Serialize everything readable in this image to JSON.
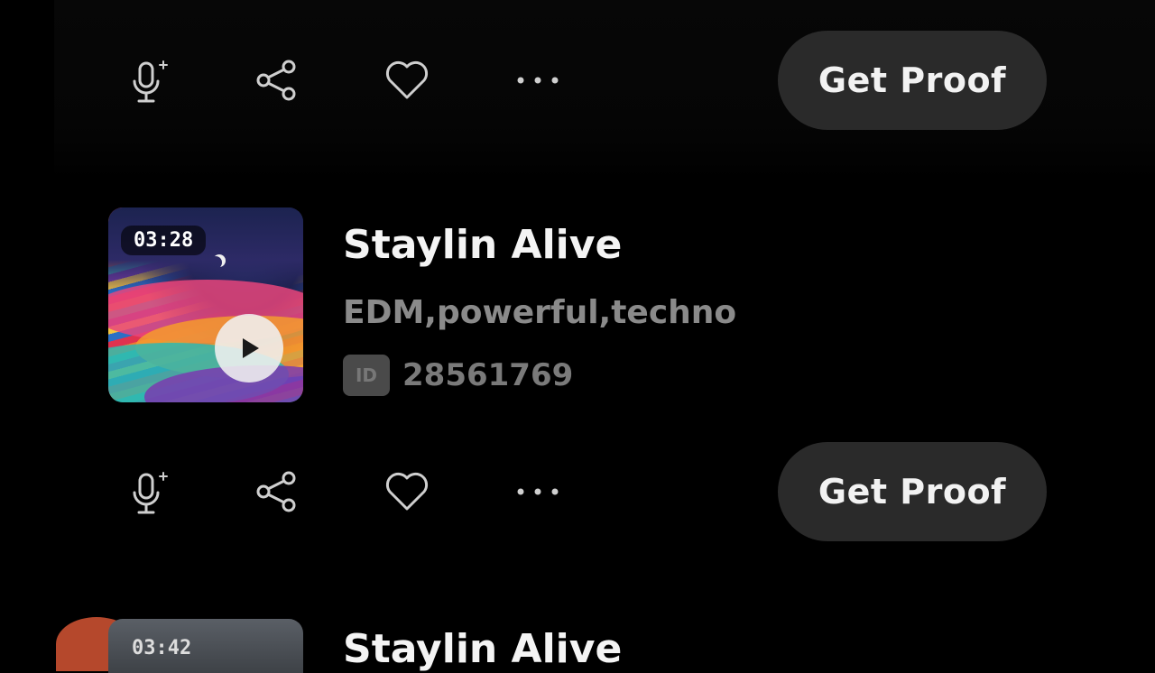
{
  "rows": [
    {
      "actions": {
        "mic_icon": "microphone-sparkle-icon",
        "share_icon": "share-icon",
        "like_icon": "heart-icon",
        "more_icon": "more-horizontal-icon",
        "proof_label": "Get Proof"
      }
    },
    {
      "duration": "03:28",
      "title": "Staylin Alive",
      "tags": "EDM,powerful,techno",
      "id_badge": "ID",
      "id_number": "28561769",
      "actions": {
        "mic_icon": "microphone-sparkle-icon",
        "share_icon": "share-icon",
        "like_icon": "heart-icon",
        "more_icon": "more-horizontal-icon",
        "proof_label": "Get Proof"
      }
    },
    {
      "duration": "03:42",
      "title": "Staylin Alive"
    }
  ],
  "colors": {
    "background": "#000000",
    "button_bg": "#2a2a2a",
    "title": "#f4f4f4",
    "subtitle": "#8a8a8a"
  }
}
